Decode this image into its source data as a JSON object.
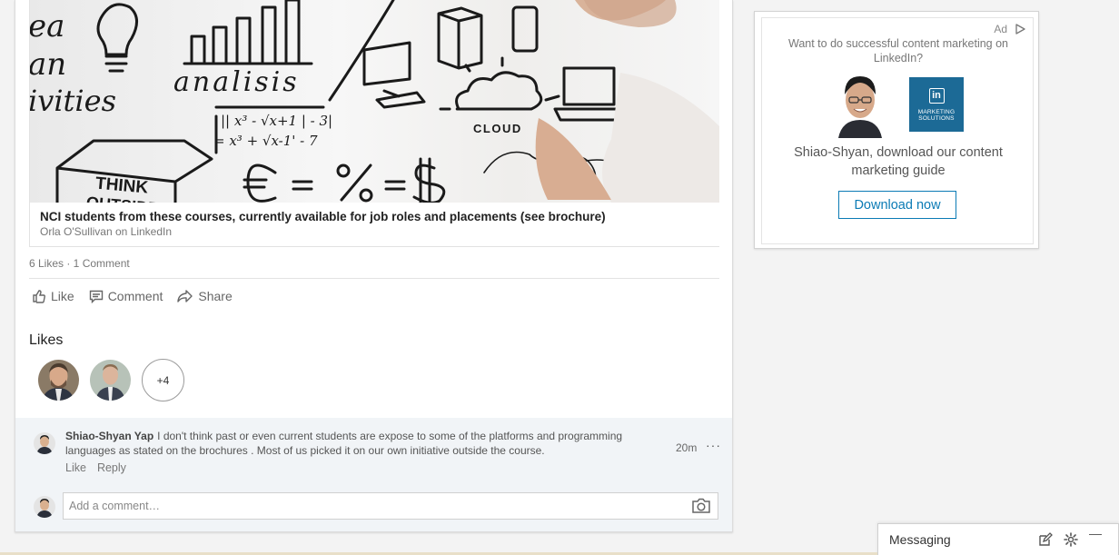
{
  "post": {
    "image_text": {
      "line1": "ea",
      "line2": "an",
      "line3": "ivities",
      "analisis": "analisis",
      "cloud": "CLOUD",
      "think": "THINK",
      "outside": "OUTSIDE",
      "formula1": "|| x³ - √x+1 | - 3|",
      "formula2": "= x³ + √x-1' - 7"
    },
    "article": {
      "title": "NCI students from these courses, currently available for job roles and placements (see brochure)",
      "source": "Orla O'Sullivan on LinkedIn"
    },
    "social_counts": "6 Likes · 1 Comment",
    "actions": {
      "like": "Like",
      "comment": "Comment",
      "share": "Share"
    },
    "likes": {
      "heading": "Likes",
      "more": "+4"
    }
  },
  "comments": [
    {
      "author": "Shiao-Shyan Yap",
      "text": "I don't think  past or even current students are expose to some of the platforms and programming languages as stated on the brochures .  Most of us picked it on our own initiative outside the course.",
      "time": "20m",
      "more": "···",
      "like": "Like",
      "reply": "Reply"
    }
  ],
  "new_comment": {
    "placeholder": "Add a comment…"
  },
  "ad": {
    "label": "Ad",
    "headline": "Want to do successful content marketing on LinkedIn?",
    "logo_mark": "in",
    "logo_line1": "MARKETING",
    "logo_line2": "SOLUTIONS",
    "body": "Shiao-Shyan, download our content marketing guide",
    "button": "Download now"
  },
  "messaging": {
    "title": "Messaging",
    "minimize": "—"
  },
  "icons": [
    "thumbs-up-icon",
    "comment-icon",
    "share-arrow-icon",
    "camera-icon",
    "ad-choices-icon",
    "compose-icon",
    "gear-icon",
    "minimize-icon"
  ],
  "colors": {
    "accent": "#0b7bb5",
    "logo_bg": "#1c6a96",
    "comment_bg": "#f1f4f7"
  }
}
